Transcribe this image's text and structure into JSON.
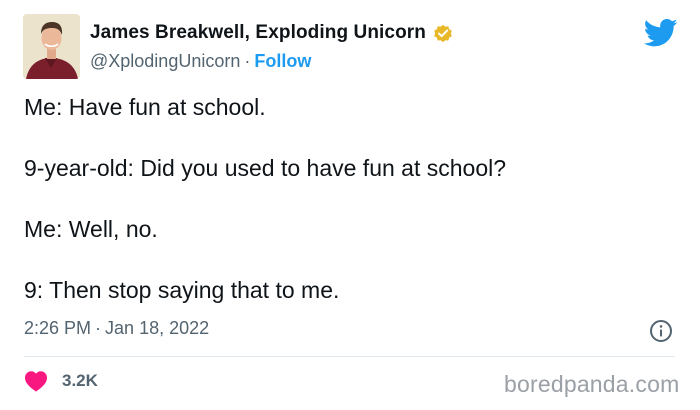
{
  "author": {
    "display_name": "James Breakwell, Exploding Unicorn",
    "handle": "@XplodingUnicorn",
    "separator": "·",
    "follow_label": "Follow",
    "verified": true,
    "verified_icon": "verified-badge-icon",
    "avatar": "avatar-photo"
  },
  "platform_icon": "twitter-bird-icon",
  "tweet": {
    "lines": [
      "Me: Have fun at school.",
      "9-year-old: Did you used to have fun at school?",
      "Me: Well, no.",
      "9: Then stop saying that to me."
    ],
    "time": "2:26 PM",
    "separator": "·",
    "date": "Jan 18, 2022",
    "info_icon": "info-icon"
  },
  "engagement": {
    "like_icon": "heart-icon",
    "likes": "3.2K"
  },
  "watermark": "boredpanda.com",
  "colors": {
    "text_primary": "#0f1419",
    "text_secondary": "#536471",
    "link": "#1d9bf0",
    "verified_gold": "#e8b829",
    "heart": "#f91880",
    "twitter_blue": "#1d9bf0",
    "watermark": "#9aa0a6"
  }
}
